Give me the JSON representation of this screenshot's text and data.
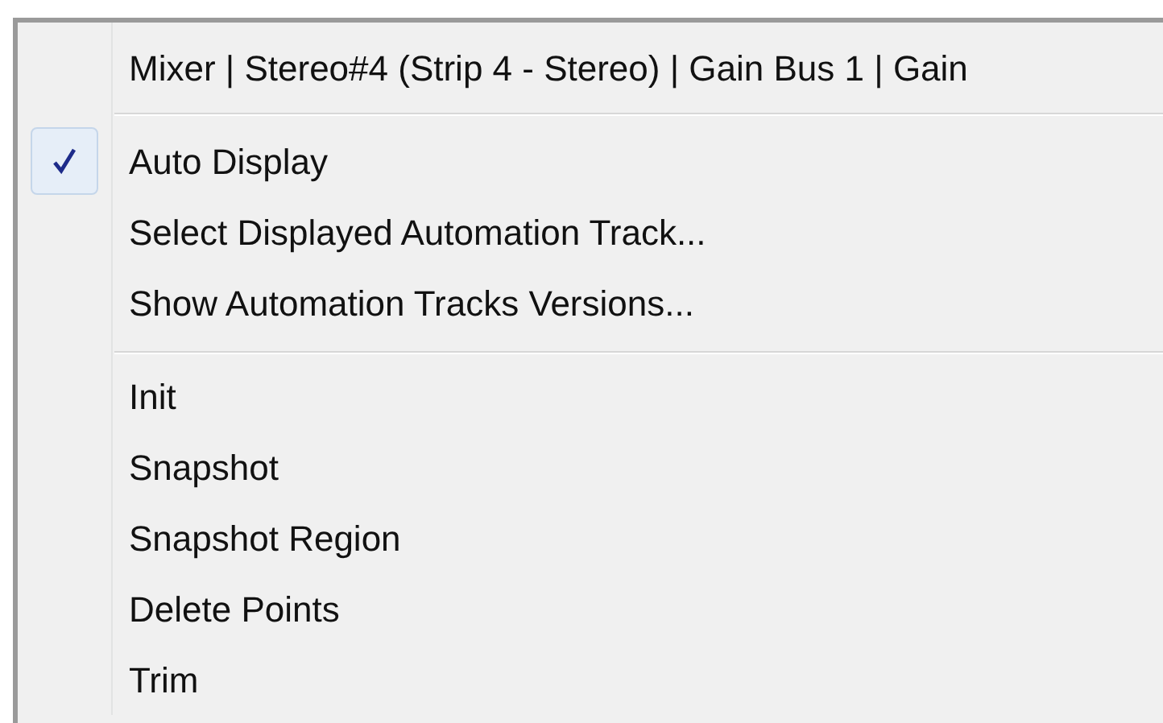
{
  "menu": {
    "title": "Mixer | Stereo#4 (Strip 4 - Stereo) | Gain Bus 1 | Gain",
    "sections": [
      {
        "items": [
          {
            "label": "Auto Display",
            "checked": true
          },
          {
            "label": "Select Displayed Automation Track...",
            "checked": false
          },
          {
            "label": "Show Automation Tracks Versions...",
            "checked": false
          }
        ]
      },
      {
        "items": [
          {
            "label": "Init",
            "checked": false
          },
          {
            "label": "Snapshot",
            "checked": false
          },
          {
            "label": "Snapshot Region",
            "checked": false
          },
          {
            "label": "Delete Points",
            "checked": false
          },
          {
            "label": "Trim",
            "checked": false
          }
        ]
      }
    ]
  }
}
